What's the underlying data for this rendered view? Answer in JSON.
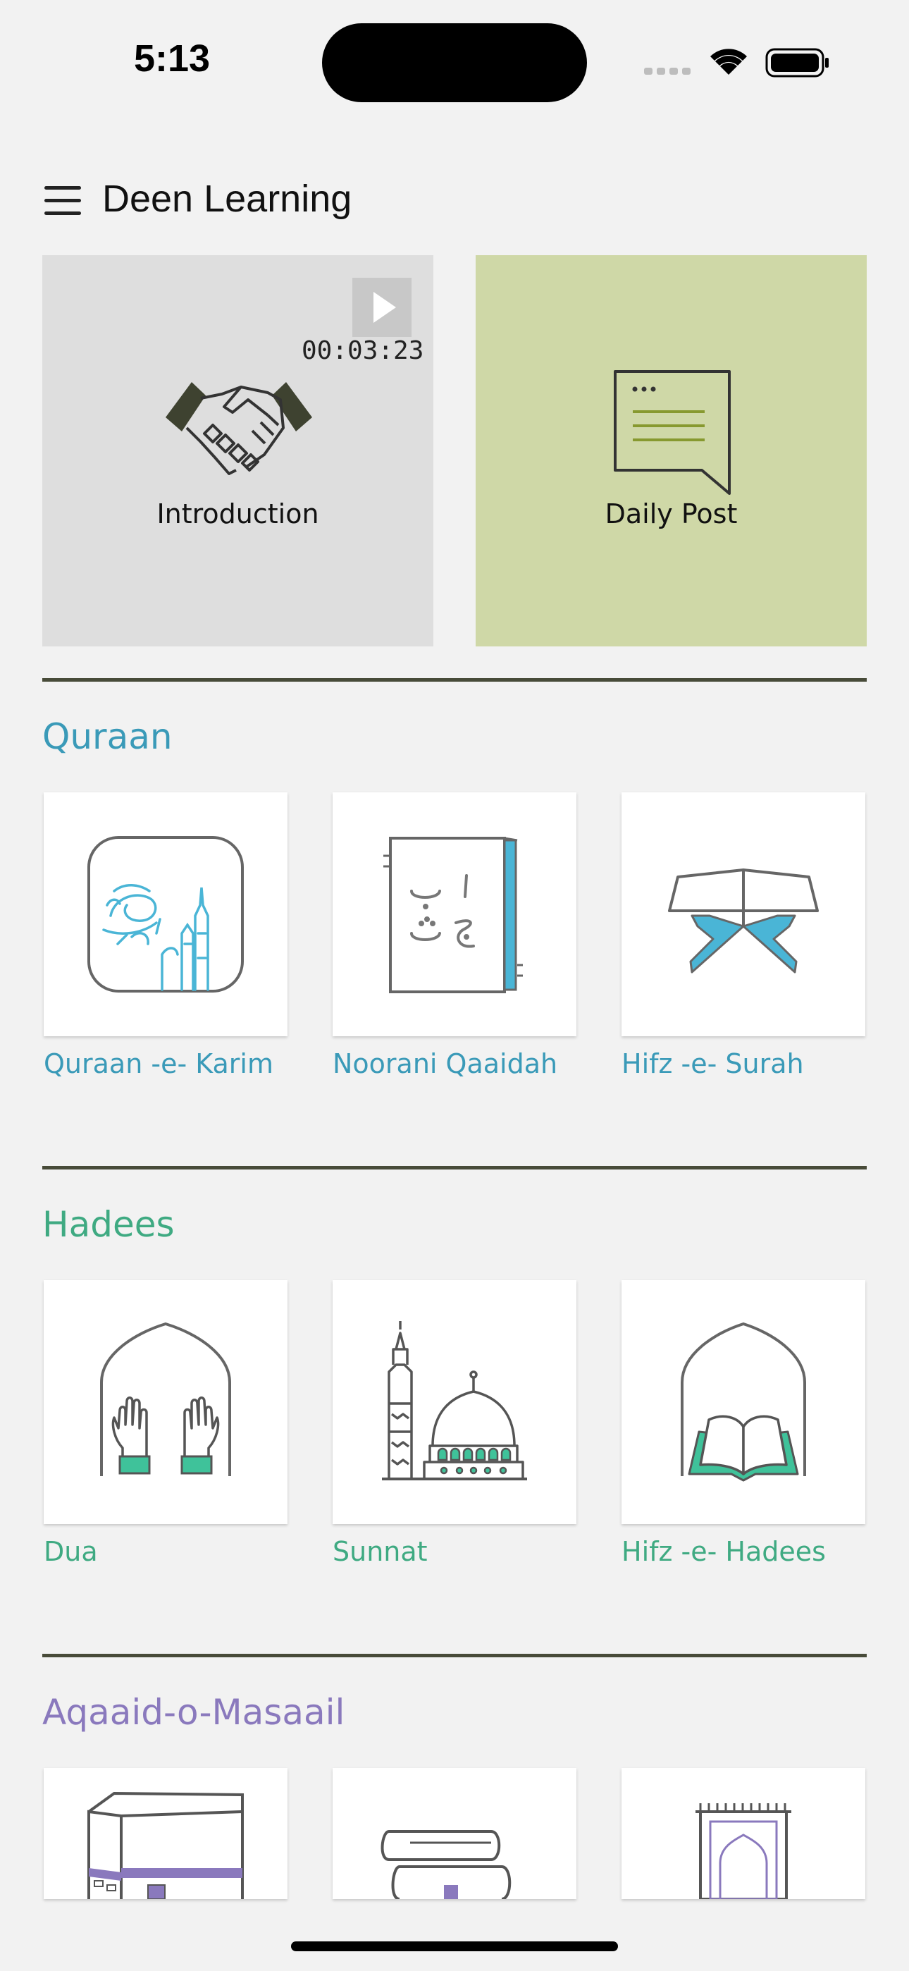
{
  "status_bar": {
    "time": "5:13"
  },
  "header": {
    "title": "Deen Learning"
  },
  "hero": {
    "intro": {
      "label": "Introduction",
      "duration": "00:03:23"
    },
    "daily": {
      "label": "Daily Post"
    }
  },
  "colors": {
    "quraan": "#3a9ab8",
    "hadees": "#3faa82",
    "aqaaid": "#8a79bd",
    "divider": "#484b39",
    "daily_bg": "#cfd8a7",
    "intro_bg": "#dedede"
  },
  "sections": [
    {
      "title": "Quraan",
      "items": [
        {
          "label": "Quraan -e- Karim",
          "icon": "quran-calligraphy-icon"
        },
        {
          "label": "Noorani Qaaidah",
          "icon": "arabic-alphabet-book-icon"
        },
        {
          "label": "Hifz -e- Surah",
          "icon": "quran-stand-icon"
        }
      ]
    },
    {
      "title": "Hadees",
      "items": [
        {
          "label": "Dua",
          "icon": "praying-hands-icon"
        },
        {
          "label": "Sunnat",
          "icon": "mosque-icon"
        },
        {
          "label": "Hifz -e- Hadees",
          "icon": "open-book-arch-icon"
        }
      ]
    },
    {
      "title": "Aqaaid-o-Masaail",
      "items": [
        {
          "label": "",
          "icon": "kaaba-icon"
        },
        {
          "label": "",
          "icon": "books-icon"
        },
        {
          "label": "",
          "icon": "prayer-mat-icon"
        }
      ]
    }
  ]
}
